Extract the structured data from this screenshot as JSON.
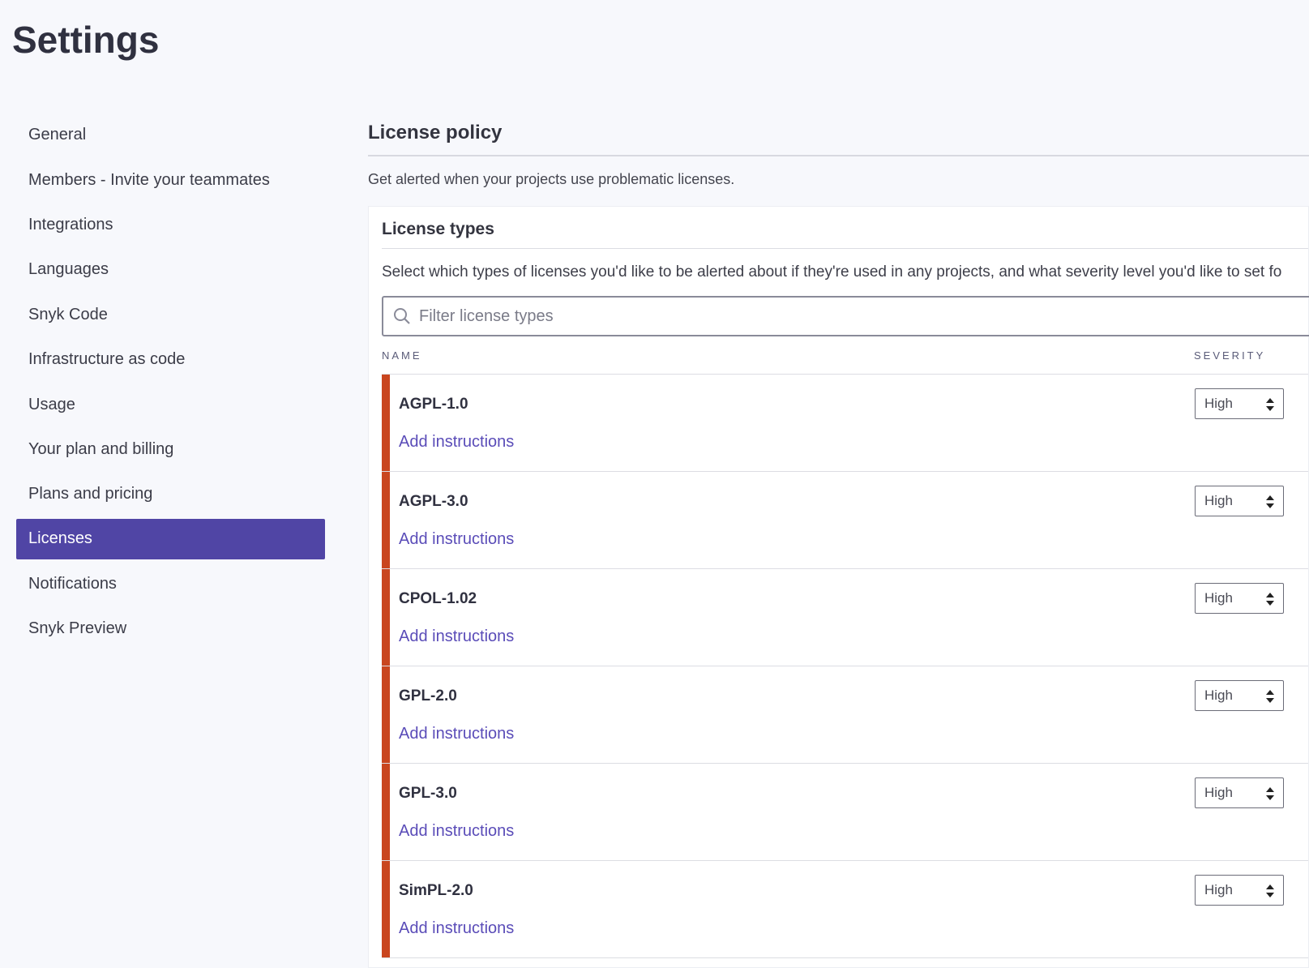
{
  "page_title": "Settings",
  "sidebar": {
    "items": [
      {
        "label": "General"
      },
      {
        "label": "Members - Invite your teammates"
      },
      {
        "label": "Integrations"
      },
      {
        "label": "Languages"
      },
      {
        "label": "Snyk Code"
      },
      {
        "label": "Infrastructure as code"
      },
      {
        "label": "Usage"
      },
      {
        "label": "Your plan and billing"
      },
      {
        "label": "Plans and pricing"
      },
      {
        "label": "Licenses",
        "active": true
      },
      {
        "label": "Notifications"
      },
      {
        "label": "Snyk Preview"
      }
    ]
  },
  "main": {
    "heading": "License policy",
    "description": "Get alerted when your projects use problematic licenses.",
    "card": {
      "title": "License types",
      "description": "Select which types of licenses you'd like to be alerted about if they're used in any projects, and what severity level you'd like to set fo",
      "filter_placeholder": "Filter license types",
      "col_name": "NAME",
      "col_severity": "SEVERITY",
      "rows": [
        {
          "name": "AGPL-1.0",
          "link": "Add instructions",
          "severity": "High"
        },
        {
          "name": "AGPL-3.0",
          "link": "Add instructions",
          "severity": "High"
        },
        {
          "name": "CPOL-1.02",
          "link": "Add instructions",
          "severity": "High"
        },
        {
          "name": "GPL-2.0",
          "link": "Add instructions",
          "severity": "High"
        },
        {
          "name": "GPL-3.0",
          "link": "Add instructions",
          "severity": "High"
        },
        {
          "name": "SimPL-2.0",
          "link": "Add instructions",
          "severity": "High"
        }
      ]
    }
  },
  "colors": {
    "accent": "#5045a5",
    "link": "#5a4cb8",
    "high_severity": "#c9461f"
  }
}
